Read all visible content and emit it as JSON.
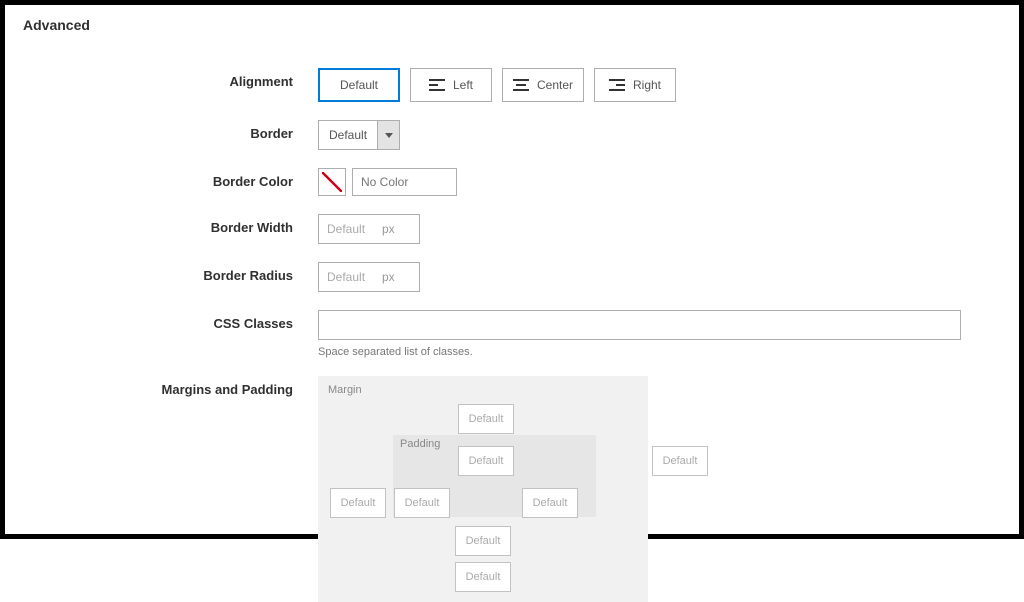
{
  "sectionTitle": "Advanced",
  "alignment": {
    "label": "Alignment",
    "options": {
      "default": "Default",
      "left": "Left",
      "center": "Center",
      "right": "Right"
    }
  },
  "border": {
    "label": "Border",
    "value": "Default"
  },
  "borderColor": {
    "label": "Border Color",
    "placeholder": "No Color"
  },
  "borderWidth": {
    "label": "Border Width",
    "placeholder": "Default",
    "unit": "px"
  },
  "borderRadius": {
    "label": "Border Radius",
    "placeholder": "Default",
    "unit": "px"
  },
  "cssClasses": {
    "label": "CSS Classes",
    "help": "Space separated list of classes."
  },
  "marginsPadding": {
    "label": "Margins and Padding",
    "marginLabel": "Margin",
    "paddingLabel": "Padding",
    "placeholder": "Default"
  }
}
